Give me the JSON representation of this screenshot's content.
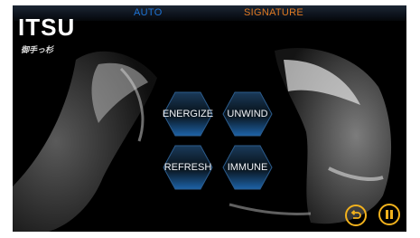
{
  "tabs": {
    "auto": "AUTO",
    "signature": "SIGNATURE"
  },
  "brand": {
    "name": "ITSU",
    "tagline": "御手っ杉"
  },
  "programs": {
    "energize": "ENERGIZE",
    "unwind": "UNWIND",
    "refresh": "REFRESH",
    "immune": "IMMUNE"
  },
  "controls": {
    "back_icon": "undo-arrow-icon",
    "pause_icon": "pause-icon"
  },
  "colors": {
    "auto_tab": "#1e74d6",
    "signature_tab": "#e07a22",
    "control_ring": "#f2b21d"
  }
}
